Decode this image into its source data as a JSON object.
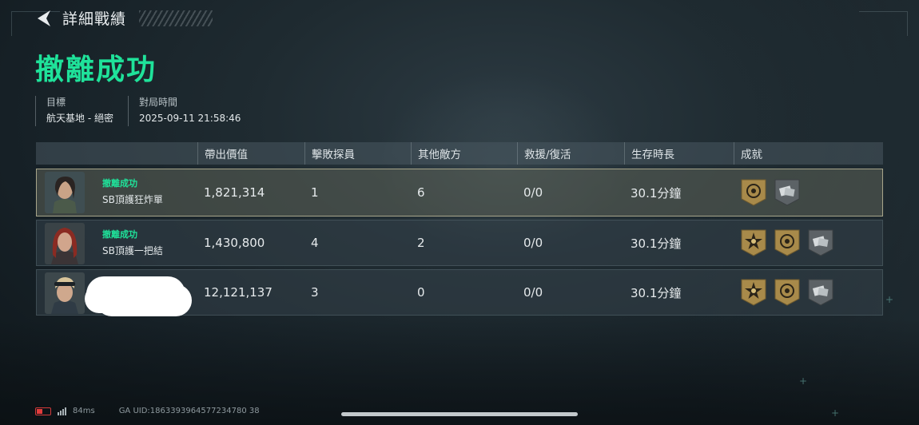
{
  "header": {
    "back_icon": "back-arrow-icon",
    "title": "詳細戰績"
  },
  "result": {
    "title": "撤離成功",
    "color": "#1fe29a"
  },
  "meta": {
    "target_label": "目標",
    "target_value": "航天基地 - 絕密",
    "time_label": "對局時間",
    "time_value": "2025-09-11 21:58:46"
  },
  "table": {
    "headers": [
      "帶出價值",
      "擊敗探員",
      "其他敵方",
      "救援/復活",
      "生存時長",
      "成就"
    ],
    "rows": [
      {
        "status": "撤離成功",
        "name": "SB頂護狂炸單",
        "value": "1,821,314",
        "defeated": "1",
        "other_enemies": "6",
        "rescue": "0/0",
        "survival": "30.1分鐘",
        "highlighted": true,
        "badges": [
          "gold-shield-badge-icon",
          "gray-card-badge-icon"
        ]
      },
      {
        "status": "撤離成功",
        "name": "SB頂護一把結",
        "value": "1,430,800",
        "defeated": "4",
        "other_enemies": "2",
        "rescue": "0/0",
        "survival": "30.1分鐘",
        "highlighted": false,
        "badges": [
          "gold-star-badge-icon",
          "gold-shield-badge-icon",
          "gray-card-badge-icon"
        ]
      },
      {
        "status": "",
        "name": "",
        "value": "12,121,137",
        "defeated": "3",
        "other_enemies": "0",
        "rescue": "0/0",
        "survival": "30.1分鐘",
        "highlighted": false,
        "badges": [
          "gold-star-badge-icon",
          "gold-shield-badge-icon",
          "gray-card-badge-icon"
        ]
      }
    ]
  },
  "footer": {
    "ping": "84ms",
    "uid": "GA UID:1863393964577234780 38",
    "battery_color": "#e23c3c"
  }
}
